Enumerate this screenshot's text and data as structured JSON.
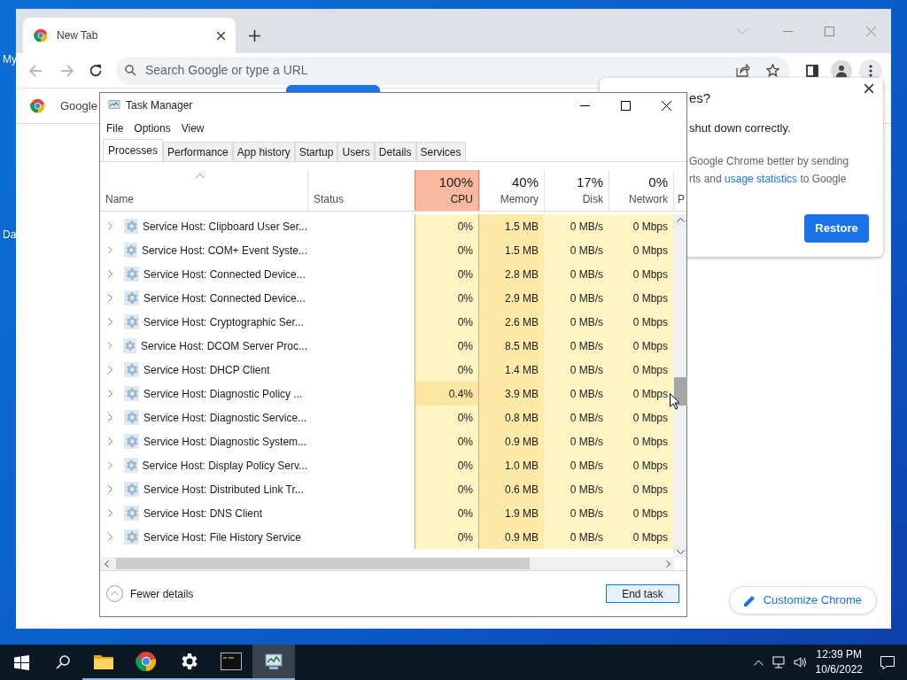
{
  "desktop_icons": [
    {
      "label": "My"
    },
    {
      "label": "Da"
    }
  ],
  "browser": {
    "tab": {
      "title": "New Tab",
      "selected": true
    },
    "omnibox": {
      "placeholder": "Search Google or type a URL"
    },
    "bookmarks": [
      {
        "label": "Google"
      }
    ],
    "popup": {
      "title": "es?",
      "message": "shut down correctly.",
      "body_lines": [
        "Google Chrome better by sending"
      ],
      "link": "usage statistics",
      "body_end": "rts and ",
      "body_after": " to Google",
      "button": "Restore"
    },
    "customize_button": "Customize Chrome"
  },
  "task_manager": {
    "title": "Task Manager",
    "menu": [
      "File",
      "Options",
      "View"
    ],
    "tabs": [
      {
        "label": "Processes",
        "selected": true
      },
      {
        "label": "Performance",
        "selected": false
      },
      {
        "label": "App history",
        "selected": false
      },
      {
        "label": "Startup",
        "selected": false
      },
      {
        "label": "Users",
        "selected": false
      },
      {
        "label": "Details",
        "selected": false
      },
      {
        "label": "Services",
        "selected": false
      }
    ],
    "columns": [
      {
        "label": "Name",
        "kind": "text"
      },
      {
        "label": "Status",
        "kind": "text"
      },
      {
        "label": "CPU",
        "percent": "100%",
        "kind": "metric",
        "hot": true
      },
      {
        "label": "Memory",
        "percent": "40%",
        "kind": "metric",
        "hot": false
      },
      {
        "label": "Disk",
        "percent": "17%",
        "kind": "metric",
        "hot": false
      },
      {
        "label": "Network",
        "percent": "0%",
        "kind": "metric",
        "hot": false
      },
      {
        "label": "P",
        "kind": "cut"
      }
    ],
    "rows": [
      {
        "name": "Service Host: Clipboard User Ser...",
        "cpu": "0%",
        "memory": "1.5 MB",
        "disk": "0 MB/s",
        "network": "0 Mbps",
        "busy": false
      },
      {
        "name": "Service Host: COM+ Event Syste...",
        "cpu": "0%",
        "memory": "1.5 MB",
        "disk": "0 MB/s",
        "network": "0 Mbps",
        "busy": false
      },
      {
        "name": "Service Host: Connected Device...",
        "cpu": "0%",
        "memory": "2.8 MB",
        "disk": "0 MB/s",
        "network": "0 Mbps",
        "busy": false
      },
      {
        "name": "Service Host: Connected Device...",
        "cpu": "0%",
        "memory": "2.9 MB",
        "disk": "0 MB/s",
        "network": "0 Mbps",
        "busy": false
      },
      {
        "name": "Service Host: Cryptographic Ser...",
        "cpu": "0%",
        "memory": "2.6 MB",
        "disk": "0 MB/s",
        "network": "0 Mbps",
        "busy": false
      },
      {
        "name": "Service Host: DCOM Server Proc...",
        "cpu": "0%",
        "memory": "8.5 MB",
        "disk": "0 MB/s",
        "network": "0 Mbps",
        "busy": false
      },
      {
        "name": "Service Host: DHCP Client",
        "cpu": "0%",
        "memory": "1.4 MB",
        "disk": "0 MB/s",
        "network": "0 Mbps",
        "busy": false
      },
      {
        "name": "Service Host: Diagnostic Policy ...",
        "cpu": "0.4%",
        "memory": "3.9 MB",
        "disk": "0 MB/s",
        "network": "0 Mbps",
        "busy": true
      },
      {
        "name": "Service Host: Diagnostic Service...",
        "cpu": "0%",
        "memory": "0.8 MB",
        "disk": "0 MB/s",
        "network": "0 Mbps",
        "busy": false
      },
      {
        "name": "Service Host: Diagnostic System...",
        "cpu": "0%",
        "memory": "0.9 MB",
        "disk": "0 MB/s",
        "network": "0 Mbps",
        "busy": false
      },
      {
        "name": "Service Host: Display Policy Serv...",
        "cpu": "0%",
        "memory": "1.0 MB",
        "disk": "0 MB/s",
        "network": "0 Mbps",
        "busy": false
      },
      {
        "name": "Service Host: Distributed Link Tr...",
        "cpu": "0%",
        "memory": "0.6 MB",
        "disk": "0 MB/s",
        "network": "0 Mbps",
        "busy": false
      },
      {
        "name": "Service Host: DNS Client",
        "cpu": "0%",
        "memory": "1.9 MB",
        "disk": "0 MB/s",
        "network": "0 Mbps",
        "busy": false
      },
      {
        "name": "Service Host: File History Service",
        "cpu": "0%",
        "memory": "0.9 MB",
        "disk": "0 MB/s",
        "network": "0 Mbps",
        "busy": false
      }
    ],
    "fewer_details": "Fewer details",
    "end_task": "End task"
  },
  "taskbar": {
    "apps": [
      {
        "kind": "folder",
        "running": true,
        "selected": false
      },
      {
        "kind": "chrome",
        "running": true,
        "selected": false
      },
      {
        "kind": "gear",
        "running": true,
        "selected": false
      },
      {
        "kind": "terminal",
        "running": true,
        "selected": false
      },
      {
        "kind": "monitor",
        "running": true,
        "selected": true
      }
    ],
    "time": "12:39 PM",
    "date": "10/6/2022"
  }
}
